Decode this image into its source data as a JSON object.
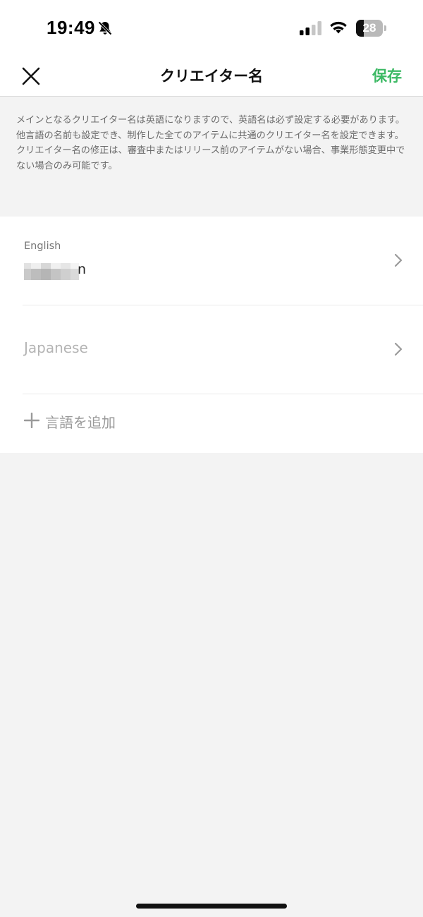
{
  "status_bar": {
    "time": "19:49",
    "battery_level": "28",
    "battery_fraction": 0.28,
    "icons": [
      "bell-slash-icon",
      "signal-icon",
      "wifi-icon",
      "battery-icon"
    ]
  },
  "header": {
    "close_icon": "close-icon",
    "title": "クリエイター名",
    "save_label": "保存",
    "accent_color": "#3cb964"
  },
  "description": {
    "lines": [
      "メインとなるクリエイター名は英語になりますので、英語名は必ず設定する必要があります。",
      "他言語の名前も設定でき、制作した全てのアイテムに共通のクリエイター名を設定できます。",
      "クリエイター名の修正は、審査中またはリリース前のアイテムがない場合、事業形態変更中でない場合のみ可能です。"
    ]
  },
  "languages": [
    {
      "label": "English",
      "value_visible_suffix": "n",
      "icon": "chevron-right-icon"
    },
    {
      "placeholder": "Japanese",
      "icon": "chevron-right-icon"
    }
  ],
  "add_language": {
    "icon": "plus-icon",
    "label": "言語を追加"
  }
}
